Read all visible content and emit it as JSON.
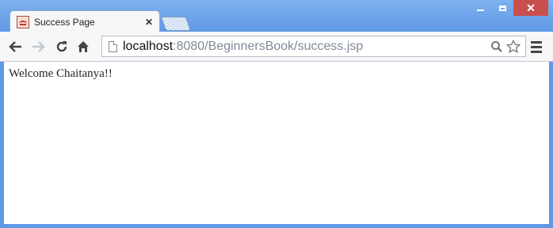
{
  "window": {
    "controls": {
      "minimize": "minimize",
      "maximize": "maximize",
      "close": "✕"
    }
  },
  "tab": {
    "title": "Success Page",
    "close_label": "✕",
    "favicon": "page-favicon-icon"
  },
  "toolbar": {
    "icons": [
      "back-arrow-icon",
      "forward-arrow-icon",
      "reload-icon",
      "home-icon",
      "search-icon",
      "star-icon",
      "menu-icon"
    ]
  },
  "address_bar": {
    "host": "localhost",
    "path": ":8080/BeginnersBook/success.jsp"
  },
  "page": {
    "message": "Welcome Chaitanya!!"
  }
}
